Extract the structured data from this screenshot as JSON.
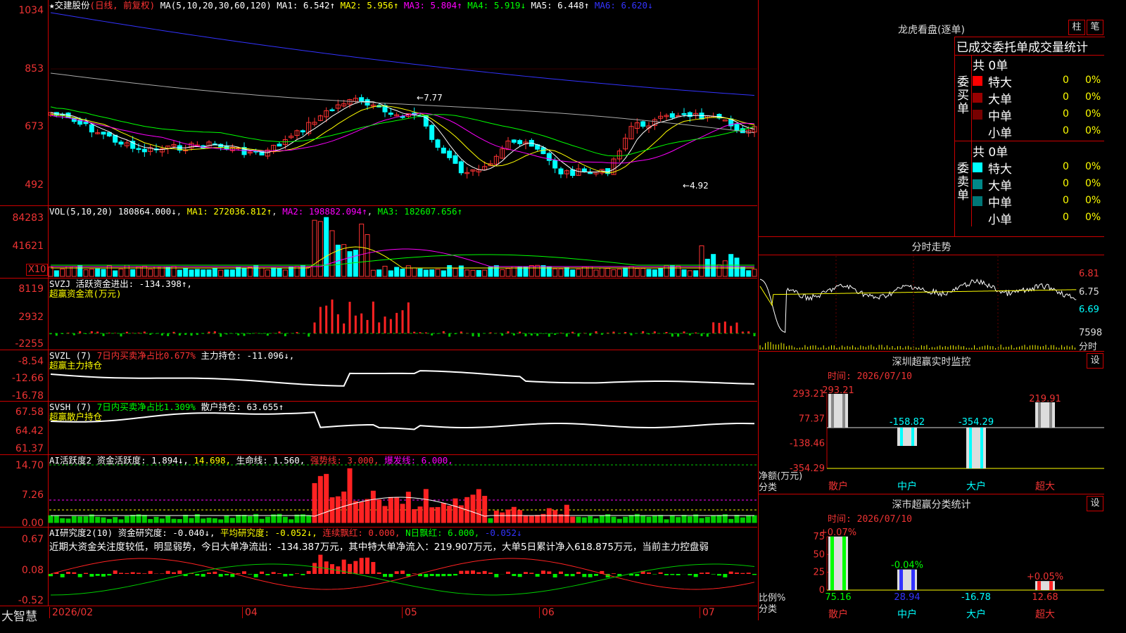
{
  "app_name": "大智慧",
  "stock": {
    "name": "交建股份",
    "mode": "(日线, 前复权)"
  },
  "ma_header": {
    "label": "MA(5,10,20,30,60,120)",
    "items": [
      {
        "k": "MA1:",
        "v": "6.542↑",
        "c": "#fff"
      },
      {
        "k": "MA2:",
        "v": "5.956↑",
        "c": "#ff0"
      },
      {
        "k": "MA3:",
        "v": "5.804↑",
        "c": "#f0f"
      },
      {
        "k": "MA4:",
        "v": "5.919↓",
        "c": "#0f0"
      },
      {
        "k": "MA5:",
        "v": "6.448↑",
        "c": "#fff"
      },
      {
        "k": "MA6:",
        "v": "6.620↓",
        "c": "#33f"
      }
    ]
  },
  "price_axis": [
    "1034",
    "853",
    "673",
    "492"
  ],
  "price_labels": {
    "high": "7.77",
    "low": "4.92"
  },
  "vol_header": {
    "label": "VOL(5,10,20)",
    "value": "180864.000↓",
    "ma1": "MA1: 272036.812↑",
    "ma2": "MA2: 198882.094↑",
    "ma3": "MA3: 182607.656↑"
  },
  "vol_axis": [
    "84283",
    "41621"
  ],
  "vol_unit": "X10",
  "svzj": {
    "l1": "SVZJ  活跃资金进出: -134.398↑,",
    "l2": "超赢资金流(万元)",
    "axis": [
      "8119",
      "2932",
      "-2255"
    ]
  },
  "svzl": {
    "l1a": "SVZL (7)",
    "l1b": "7日内买卖净占比0.677%",
    "l1c": "主力持仓: -11.096↓,",
    "l2": "超赢主力持仓",
    "axis": [
      "-8.54",
      "-12.66",
      "-16.78"
    ]
  },
  "svsh": {
    "l1a": "SVSH (7)",
    "l1b": "7日内买卖净占比1.309%",
    "l1c": "散户持仓: 63.655↑",
    "l2": "超赢散户持仓",
    "axis": [
      "67.58",
      "64.42",
      "61.37"
    ]
  },
  "ai_act": {
    "a": "AI活跃度2",
    "b": "资金活跃度: 1.894↓,",
    "c": "14.698,",
    "d": "生命线: 1.560,",
    "e": "强势线: 3.000,",
    "f": "爆发线: 6.000,",
    "axis": [
      "14.70",
      "7.26",
      "0.00"
    ]
  },
  "ai_res": {
    "a": "AI研究度2(10)",
    "b": "资金研究度: -0.040↓,",
    "c": "平均研究度: -0.052↓,",
    "d": "连续飘红: 0.000,",
    "e": "N日飘红: 6.000,",
    "f": "-0.052↓",
    "note": "近期大资金关注度较低，明显弱势，今日大单净流出：-134.387万元，其中特大单净流入：219.907万元，大单5日累计净入618.875万元，当前主力控盘弱",
    "axis": [
      "0.67",
      "0.08",
      "-0.52"
    ]
  },
  "date_axis": {
    "first": "2026/02",
    "months": [
      "04",
      "05",
      "06",
      "07"
    ]
  },
  "dragon": {
    "title": "龙虎看盘(逐单)",
    "btn1": "柱",
    "btn2": "笔",
    "tabs": "已成交委托单成交量统计",
    "buy": {
      "side": "委买单",
      "total": "共 0单",
      "rows": [
        {
          "n": "特大",
          "c": "#f00",
          "v": "0",
          "p": "0%"
        },
        {
          "n": "大单",
          "c": "#900",
          "v": "0",
          "p": "0%"
        },
        {
          "n": "中单",
          "c": "#700",
          "v": "0",
          "p": "0%"
        },
        {
          "n": "小单",
          "c": "",
          "v": "0",
          "p": "0%"
        }
      ]
    },
    "sell": {
      "side": "委卖单",
      "total": "共 0单",
      "rows": [
        {
          "n": "特大",
          "c": "#0ff",
          "v": "0",
          "p": "0%"
        },
        {
          "n": "大单",
          "c": "#088",
          "v": "0",
          "p": "0%"
        },
        {
          "n": "中单",
          "c": "#077",
          "v": "0",
          "p": "0%"
        },
        {
          "n": "小单",
          "c": "",
          "v": "0",
          "p": "0%"
        }
      ]
    }
  },
  "intraday": {
    "title": "分时走势",
    "axis": [
      "6.81",
      "6.75",
      "6.69"
    ],
    "vol": "7598",
    "vol_unit": "分时"
  },
  "monitor": {
    "title": "深圳超赢实时监控",
    "btn": "设",
    "time": "时间: 2026/07/10",
    "axis": [
      "293.21",
      "77.37",
      "-138.46",
      "-354.29"
    ],
    "ylabel1": "净额(万元)",
    "ylabel2": "分类",
    "bars": [
      {
        "name": "散户",
        "value": 293.21,
        "label": "293.21"
      },
      {
        "name": "中户",
        "value": -158.82,
        "label": "-158.82"
      },
      {
        "name": "大户",
        "value": -354.29,
        "label": "-354.29"
      },
      {
        "name": "超大",
        "value": 219.91,
        "label": "219.91"
      }
    ]
  },
  "stat": {
    "title": "深市超赢分类统计",
    "btn": "设",
    "time": "时间: 2026/07/10",
    "axis": [
      "75",
      "50",
      "25",
      "0"
    ],
    "ylabel1": "比例%",
    "ylabel2": "分类",
    "bars": [
      {
        "name": "散户",
        "value": 75.16,
        "top": "+0.07%",
        "bottom": "75.16"
      },
      {
        "name": "中户",
        "value": 28.94,
        "top": "-0.04%",
        "bottom": "28.94"
      },
      {
        "name": "大户",
        "value": -16.78,
        "top": "",
        "bottom": "-16.78"
      },
      {
        "name": "超大",
        "value": 12.68,
        "top": "+0.05%",
        "bottom": "12.68"
      }
    ]
  }
}
